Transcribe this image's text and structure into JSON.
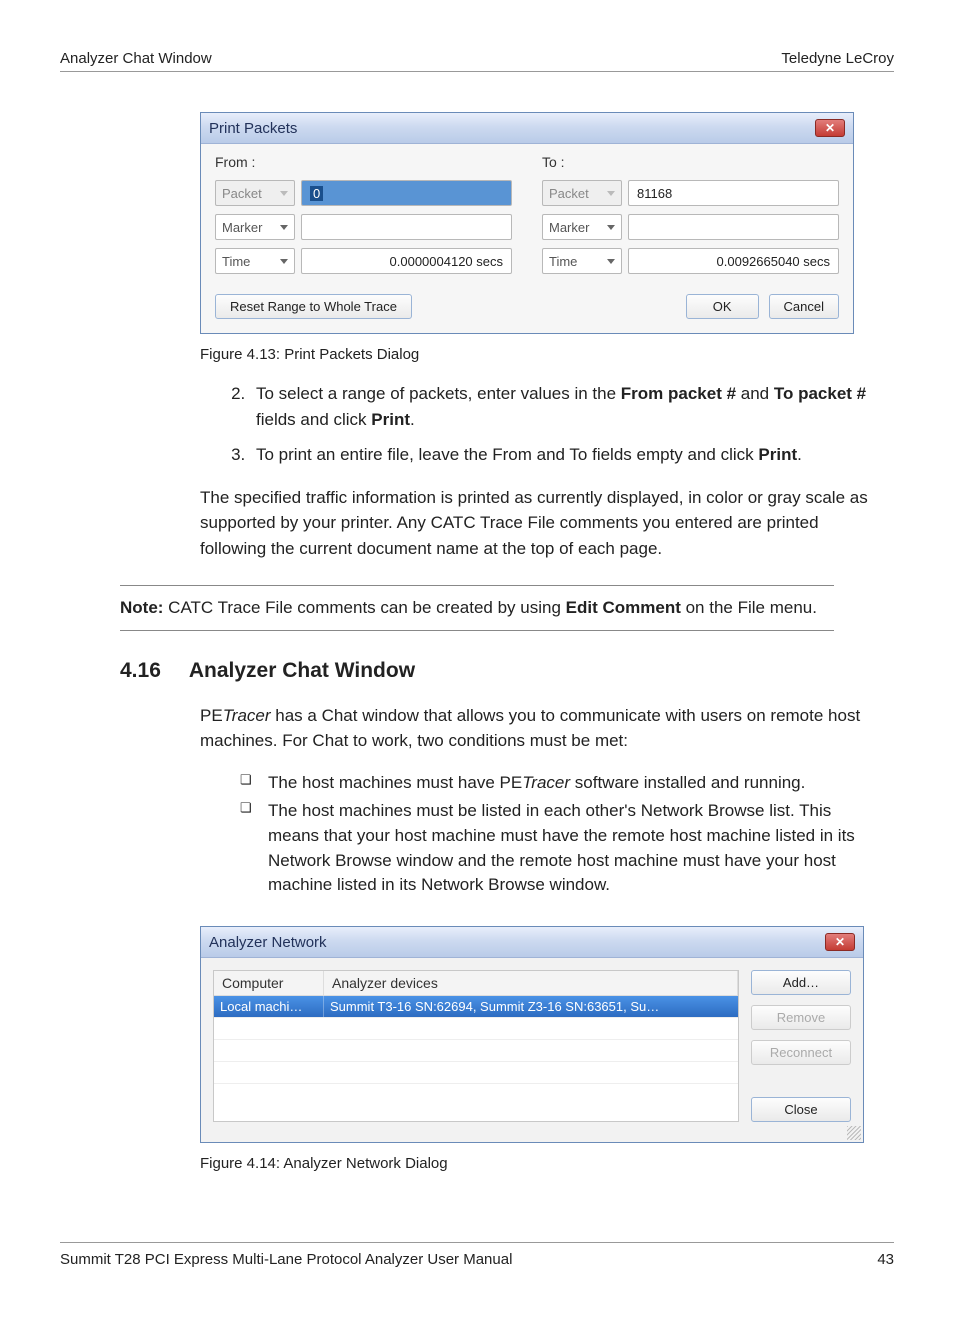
{
  "header": {
    "left": "Analyzer Chat Window",
    "right": "Teledyne LeCroy"
  },
  "printPackets": {
    "title": "Print Packets",
    "fromLabel": "From :",
    "toLabel": "To :",
    "packetLabel": "Packet",
    "markerLabel": "Marker",
    "timeLabel": "Time",
    "fromPacket": "0",
    "toPacket": "81168",
    "fromMarker": "",
    "toMarker": "",
    "fromTime": "0.0000004120 secs",
    "toTime": "0.0092665040 secs",
    "resetBtn": "Reset Range to Whole Trace",
    "okBtn": "OK",
    "cancelBtn": "Cancel"
  },
  "captions": {
    "fig413": "Figure 4.13:  Print Packets Dialog",
    "fig414": "Figure 4.14:  Analyzer Network Dialog"
  },
  "list": {
    "item2a": "To select a range of packets, enter values in the ",
    "item2b1": "From packet #",
    "item2c": " and ",
    "item2b2": "To packet #",
    "item2d": " fields and click ",
    "item2e": "Print",
    "item2f": ".",
    "item3a": "To print an entire file, leave the From and To fields empty and click ",
    "item3b": "Print",
    "item3c": "."
  },
  "para1": "The specified traffic information is printed as currently displayed, in color or gray scale as supported by your printer. Any CATC Trace File comments you entered are printed following the current document name at the top of each page.",
  "note": {
    "label": "Note:",
    "textA": " CATC Trace File comments can be created by using ",
    "bold": "Edit Comment",
    "textB": " on the File menu."
  },
  "section": {
    "num": "4.16",
    "title": "Analyzer Chat Window"
  },
  "para2a": "PE",
  "para2b": "Tracer",
  "para2c": " has a Chat window that allows you to communicate with users on remote host machines. For Chat to work, two conditions must be met:",
  "bullets": {
    "b1a": "The host machines must have PE",
    "b1b": "Tracer",
    "b1c": " software installed and running.",
    "b2": "The host machines must be listed in each other's Network Browse list. This means that your host machine must have the remote host machine listed in its Network Browse window and the remote host machine must have your host machine listed in its Network Browse window."
  },
  "analyzerNetwork": {
    "title": "Analyzer Network",
    "colComputer": "Computer",
    "colDevices": "Analyzer devices",
    "rowComputer": "Local machi…",
    "rowDevices": "Summit T3-16 SN:62694, Summit Z3-16 SN:63651, Su…",
    "addBtn": "Add…",
    "removeBtn": "Remove",
    "reconnectBtn": "Reconnect",
    "closeBtn": "Close"
  },
  "footer": {
    "left": "Summit T28 PCI Express Multi-Lane Protocol Analyzer User Manual",
    "right": "43"
  }
}
